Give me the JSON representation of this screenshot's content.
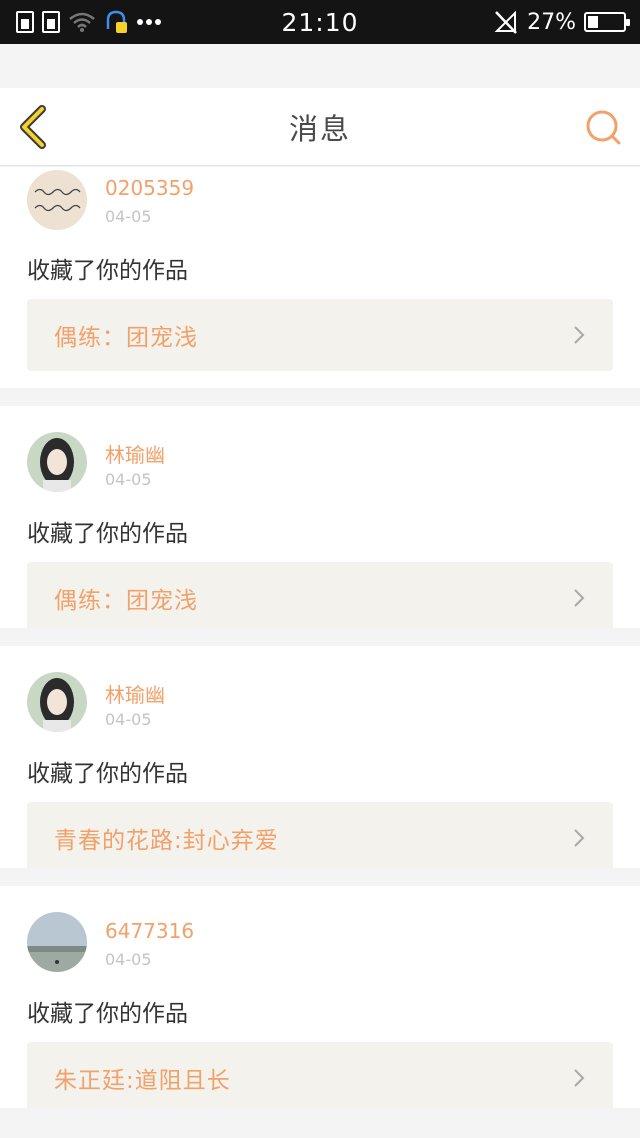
{
  "status_bar": {
    "time": "21:10",
    "battery_pct": "27%",
    "icons": [
      "sim1-icon",
      "sim2-icon",
      "wifi-icon",
      "notification-icon",
      "more-dots-icon",
      "no-signal-icon",
      "battery-icon"
    ]
  },
  "header": {
    "title": "消息",
    "back_icon": "chevron-left-icon",
    "search_icon": "search-icon",
    "accent_color": "#f2a16a"
  },
  "messages": [
    {
      "user": "0205359",
      "date": "04-05",
      "action": "收藏了你的作品",
      "work": "偶练：团宠浅",
      "avatar": "handwriting-avatar"
    },
    {
      "user": "林瑜幽",
      "date": "04-05",
      "action": "收藏了你的作品",
      "work": "偶练：团宠浅",
      "avatar": "girl-portrait-avatar"
    },
    {
      "user": "林瑜幽",
      "date": "04-05",
      "action": "收藏了你的作品",
      "work": "青春的花路:封心弃爱",
      "avatar": "girl-portrait-avatar"
    },
    {
      "user": "6477316",
      "date": "04-05",
      "action": "收藏了你的作品",
      "work": "朱正廷:道阻且长",
      "avatar": "sunset-landscape-avatar"
    }
  ]
}
